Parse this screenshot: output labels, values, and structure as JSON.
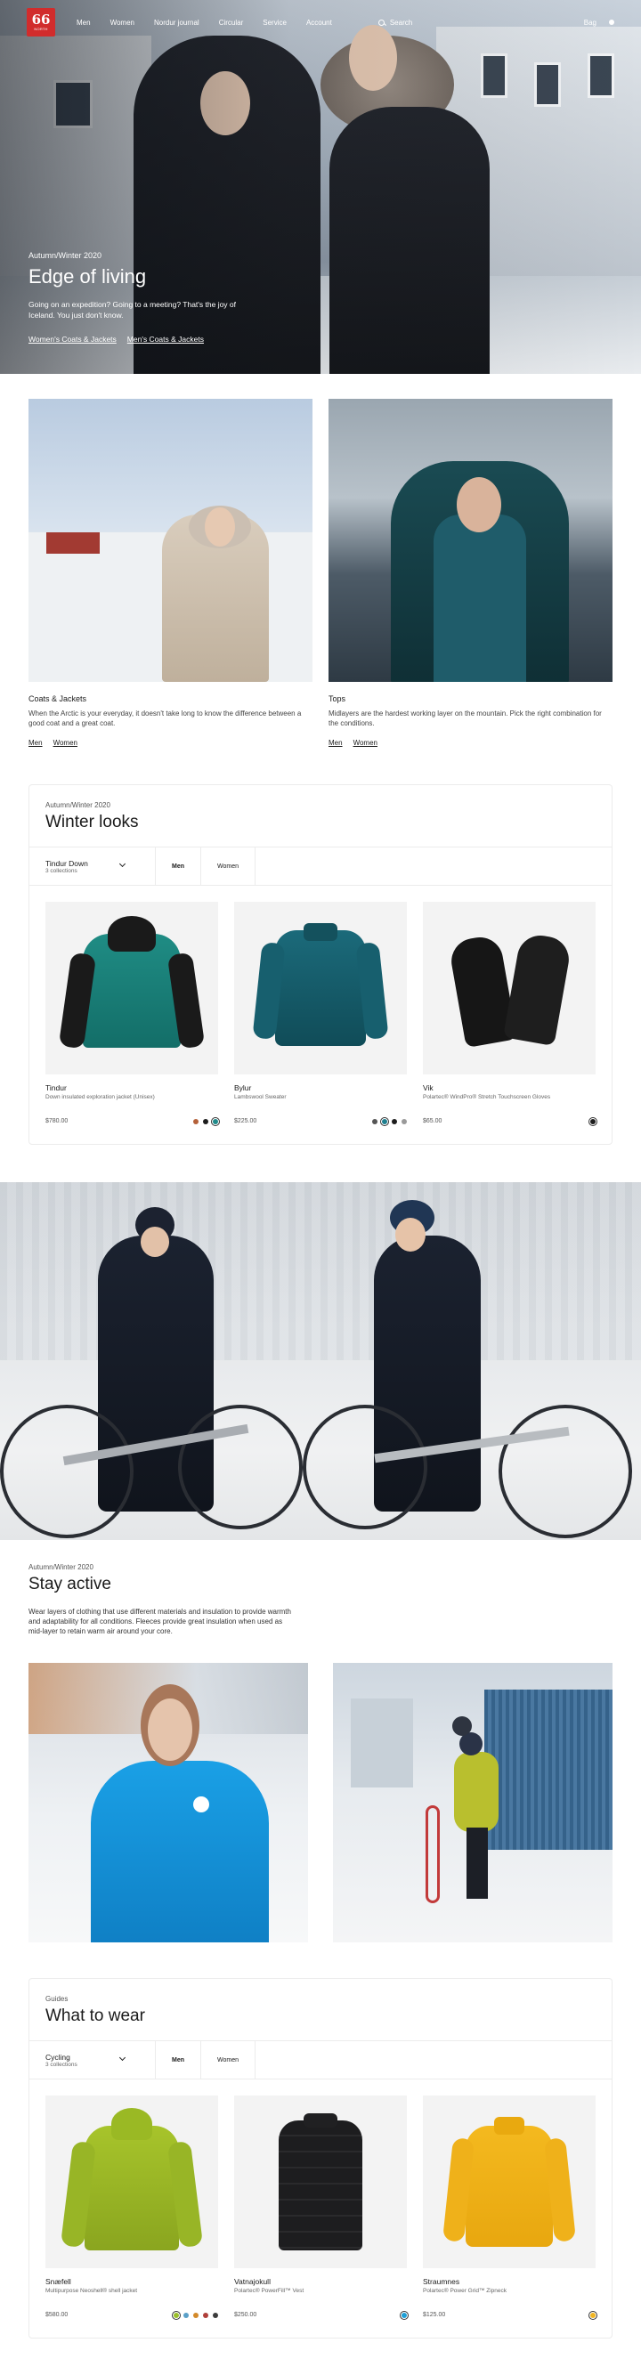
{
  "nav": {
    "logo_big": "66",
    "logo_small": "NORTH",
    "links": [
      "Men",
      "Women",
      "Nordur journal",
      "Circular",
      "Service",
      "Account"
    ],
    "search_label": "Search",
    "bag_label": "Bag"
  },
  "hero": {
    "eyebrow": "Autumn/Winter 2020",
    "title": "Edge of living",
    "text": "Going on an expedition? Going to a meeting? That's the joy of Iceland. You just don't know.",
    "link_women": "Women's Coats & Jackets",
    "link_men": "Men's Coats & Jackets"
  },
  "tiles": [
    {
      "title": "Coats & Jackets",
      "text": "When the Arctic is your everyday, it doesn't take long to know the difference between a good coat and a great coat.",
      "link_men": "Men",
      "link_women": "Women"
    },
    {
      "title": "Tops",
      "text": "Midlayers are the hardest working layer on the mountain. Pick the right combination for the conditions.",
      "link_men": "Men",
      "link_women": "Women"
    }
  ],
  "winter": {
    "eyebrow": "Autumn/Winter 2020",
    "title": "Winter looks",
    "filter_title": "Tindur Down",
    "filter_sub": "3 collections",
    "seg_men": "Men",
    "seg_women": "Women",
    "products": [
      {
        "name": "Tindur",
        "desc": "Down insulated exploration jacket (Unisex)",
        "price": "$780.00",
        "swatches": [
          "#b4613a",
          "#1c1c1c",
          "#1f8a8a"
        ],
        "selected": 2
      },
      {
        "name": "Bylur",
        "desc": "Lambswool Sweater",
        "price": "$225.00",
        "swatches": [
          "#555555",
          "#1f7f8f",
          "#1c1c1c",
          "#9a9a9a"
        ],
        "selected": 1
      },
      {
        "name": "Vik",
        "desc": "Polartec® WindPro® Stretch Touchscreen Gloves",
        "price": "$65.00",
        "swatches": [
          "#1c1c1c"
        ],
        "selected": 0
      }
    ]
  },
  "stay": {
    "eyebrow": "Autumn/Winter 2020",
    "title": "Stay active",
    "text": "Wear layers of clothing that use different materials and insulation to provide warmth and adaptability for all conditions. Fleeces provide great insulation when used as mid-layer to retain warm air around your core."
  },
  "guides": {
    "eyebrow": "Guides",
    "title": "What to wear",
    "filter_title": "Cycling",
    "filter_sub": "3 collections",
    "seg_men": "Men",
    "seg_women": "Women",
    "products": [
      {
        "name": "Snæfell",
        "desc": "Multipurpose Neoshell® shell jacket",
        "price": "$580.00",
        "swatches": [
          "#9bbf2a",
          "#5aa0c8",
          "#d38a2b",
          "#b0403b",
          "#3c3c3c"
        ],
        "selected": 0
      },
      {
        "name": "Vatnajokull",
        "desc": "Polartec® PowerFill™ Vest",
        "price": "$250.00",
        "swatches": [
          "#1f9fd6"
        ],
        "selected": 0
      },
      {
        "name": "Straumnes",
        "desc": "Polartec® Power Grid™ Zipneck",
        "price": "$125.00",
        "swatches": [
          "#f0b422"
        ],
        "selected": 0
      }
    ]
  }
}
